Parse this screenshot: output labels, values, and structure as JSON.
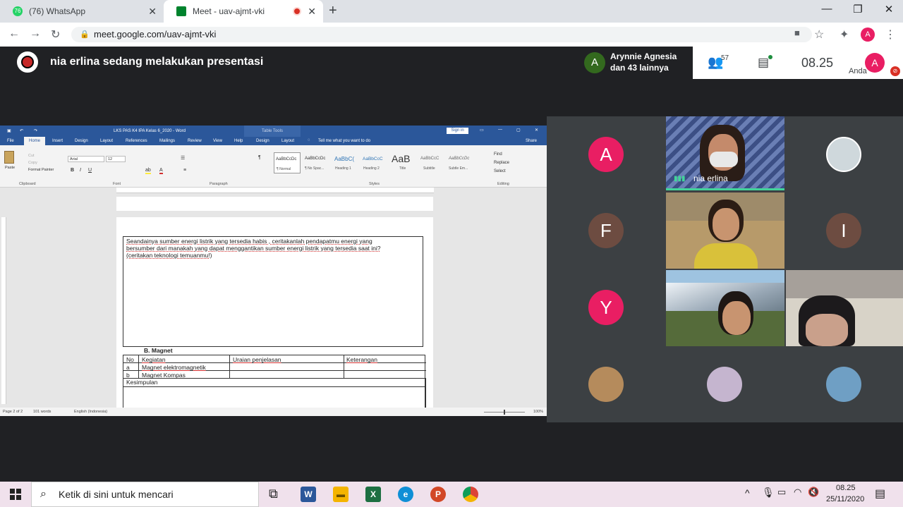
{
  "browser": {
    "tabs": [
      {
        "label": "(76) WhatsApp",
        "badge": "76"
      },
      {
        "label": "Meet - uav-ajmt-vki"
      }
    ],
    "url": "meet.google.com/uav-ajmt-vki",
    "profile": "A"
  },
  "meet": {
    "presenter_text": "nia erlina sedang melakukan presentasi",
    "participant_avatar": "A",
    "participant_line1": "Arynnie Agnesia",
    "participant_line2": "dan 43 lainnya",
    "people_count": "57",
    "time": "08.25",
    "self_label": "Anda",
    "self_avatar": "A",
    "colors": {
      "avatar_a": "#33691e",
      "self": "#e91e63"
    }
  },
  "word": {
    "title": "LKS PAS K4 IPA Kelas 6_2020 - Word",
    "table_tools": "Table Tools",
    "signin": "Sign in",
    "ribbon_tabs": [
      "File",
      "Home",
      "Insert",
      "Design",
      "Layout",
      "References",
      "Mailings",
      "Review",
      "View",
      "Help",
      "Design",
      "Layout"
    ],
    "tell_me": "Tell me what you want to do",
    "share": "Share",
    "clipboard": {
      "paste": "Paste",
      "cut": "Cut",
      "copy": "Copy",
      "format_painter": "Format Painter",
      "group": "Clipboard"
    },
    "font": {
      "name": "Arial",
      "size": "12",
      "group": "Font"
    },
    "paragraph_group": "Paragraph",
    "styles": [
      {
        "preview": "AaBbCcDc",
        "label": "¶ Normal"
      },
      {
        "preview": "AaBbCcDc",
        "label": "¶ No Spac..."
      },
      {
        "preview": "AaBbC(",
        "label": "Heading 1"
      },
      {
        "preview": "AaBbCcC",
        "label": "Heading 2"
      },
      {
        "preview": "AaB",
        "label": "Title"
      },
      {
        "preview": "AaBbCcC",
        "label": "Subtitle"
      },
      {
        "preview": "AaBbCcDc",
        "label": "Subtle Em..."
      }
    ],
    "styles_group": "Styles",
    "editing": {
      "find": "Find",
      "replace": "Replace",
      "select": "Select",
      "group": "Editing"
    },
    "question_line1": "Seandainya sumber energi listrik yang tersedia habis , ceritakanlah pendapatmu energi yang",
    "question_line2": "bersumber dari manakah yang dapat menggantikan sumber energi listrik yang tersedia saat ini?",
    "question_line3": "(ceritakan teknologi temuanmu!)",
    "section_heading": "B.  Magnet",
    "table_headers": [
      "No",
      "Kegiatan",
      "Uraian penjelasan",
      "Keterangan"
    ],
    "table_rows": [
      [
        "a",
        "Magnet elektromagnetik",
        "",
        ""
      ],
      [
        "b",
        "Magnet Kompas",
        "",
        ""
      ]
    ],
    "table_conclusion": "Kesimpulan",
    "status": {
      "page": "Page 2 of 2",
      "words": "101 words",
      "language": "English (Indonesia)",
      "zoom": "100%"
    }
  },
  "grid": {
    "avatars": [
      "A",
      "I",
      "F",
      "Y"
    ],
    "presenter_name": "nia erlina",
    "colors": {
      "A": "#e91e63",
      "F": "#6d4c41",
      "I": "#6d4c41",
      "Y": "#e91e63"
    }
  },
  "taskbar": {
    "search_placeholder": "Ketik di sini untuk mencari",
    "time": "08.25",
    "date": "25/11/2020"
  }
}
